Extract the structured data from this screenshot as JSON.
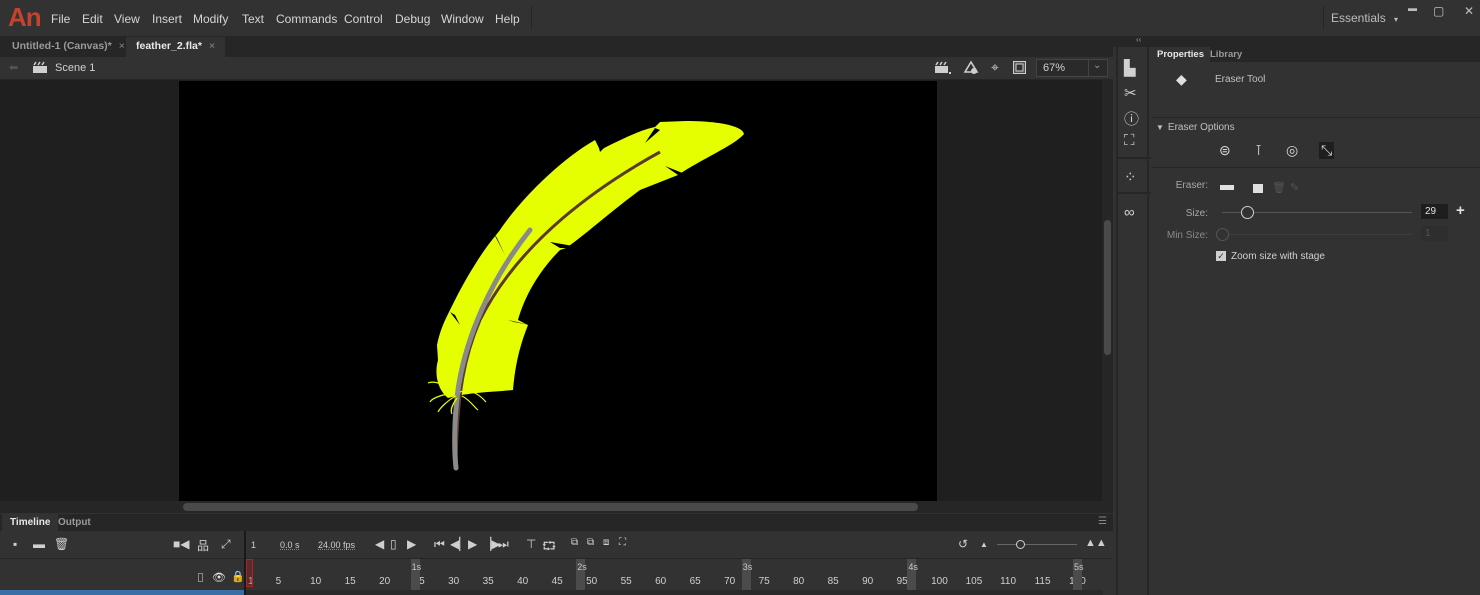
{
  "app": {
    "logo": "An"
  },
  "menu": [
    "File",
    "Edit",
    "View",
    "Insert",
    "Modify",
    "Text",
    "Commands",
    "Control",
    "Debug",
    "Window",
    "Help"
  ],
  "workspace": {
    "label": "Essentials",
    "caret": "▾"
  },
  "window_controls": {
    "minimize": "▬",
    "maximize": "▢",
    "close": "✕"
  },
  "doc_tabs": [
    {
      "label": "Untitled-1 (Canvas)*",
      "close": "×"
    },
    {
      "label": "feather_2.fla*",
      "close": "×",
      "active": true
    }
  ],
  "scene": {
    "back": "⬅",
    "label": "Scene 1",
    "zoom": "67%",
    "zoom_caret": "⌄"
  },
  "stage": {
    "background": "#000000",
    "feather_color": "#e6ff00",
    "quill_color": "#8a8a8a"
  },
  "timeline": {
    "tabs": [
      "Timeline",
      "Output"
    ],
    "current_frame": "1",
    "time": "0.0 s",
    "fps": "24.00 fps",
    "seconds": [
      "1s",
      "2s",
      "3s",
      "4s",
      "5s"
    ],
    "frame_numbers": [
      "1",
      "5",
      "10",
      "15",
      "20",
      "25",
      "30",
      "35",
      "40",
      "45",
      "50",
      "55",
      "60",
      "65",
      "70",
      "75",
      "80",
      "85",
      "90",
      "95",
      "100",
      "105",
      "110",
      "115",
      "120"
    ]
  },
  "properties": {
    "tabs": [
      "Properties",
      "Library"
    ],
    "tool_name": "Eraser Tool",
    "section": "Eraser Options",
    "eraser_label": "Eraser:",
    "size_label": "Size:",
    "size_value": "29",
    "size_fraction": 0.1,
    "min_size_label": "Min Size:",
    "min_size_value": "1",
    "zoom_checkbox_label": "Zoom size with stage",
    "zoom_checked": true
  }
}
